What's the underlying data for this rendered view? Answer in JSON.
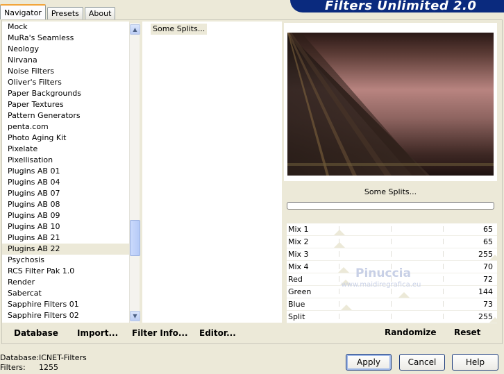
{
  "tabs": [
    {
      "label": "Navigator",
      "active": true
    },
    {
      "label": "Presets",
      "active": false
    },
    {
      "label": "About",
      "active": false
    }
  ],
  "brand": {
    "title": "Filters Unlimited 2.0"
  },
  "categories": [
    "Mock",
    "MuRa's Seamless",
    "Neology",
    "Nirvana",
    "Noise Filters",
    "Oliver's Filters",
    "Paper Backgrounds",
    "Paper Textures",
    "Pattern Generators",
    "penta.com",
    "Photo Aging Kit",
    "Pixelate",
    "Pixellisation",
    "Plugins AB 01",
    "Plugins AB 04",
    "Plugins AB 07",
    "Plugins AB 08",
    "Plugins AB 09",
    "Plugins AB 10",
    "Plugins AB 21",
    "Plugins AB 22",
    "Psychosis",
    "RCS Filter Pak 1.0",
    "Render",
    "Sabercat",
    "Sapphire Filters 01",
    "Sapphire Filters 02"
  ],
  "selected_category": "Plugins AB 22",
  "filters": [
    "Some Splits..."
  ],
  "links": {
    "database": "Database",
    "import": "Import...",
    "filter_info": "Filter Info...",
    "editor": "Editor..."
  },
  "preview": {
    "filter_name": "Some Splits..."
  },
  "params": [
    {
      "label": "Mix 1",
      "value": 65
    },
    {
      "label": "Mix 2",
      "value": 65
    },
    {
      "label": "Mix 3",
      "value": 255
    },
    {
      "label": "Mix 4",
      "value": 70
    },
    {
      "label": "Red",
      "value": 72
    },
    {
      "label": "Green",
      "value": 144
    },
    {
      "label": "Blue",
      "value": 73
    },
    {
      "label": "Split",
      "value": 255
    }
  ],
  "actions": {
    "randomize": "Randomize",
    "reset": "Reset"
  },
  "status": {
    "database_label": "Database:",
    "database_value": "ICNET-Filters",
    "filters_label": "Filters:",
    "filters_value": "1255"
  },
  "buttons": {
    "apply": "Apply",
    "cancel": "Cancel",
    "help": "Help"
  },
  "watermark": {
    "name": "Pinuccia",
    "url": "www.maidiregrafica.eu"
  },
  "colors": {
    "brand": "#0a2a7e",
    "tab_active": "#f2a43a",
    "background": "#ece9d8"
  }
}
